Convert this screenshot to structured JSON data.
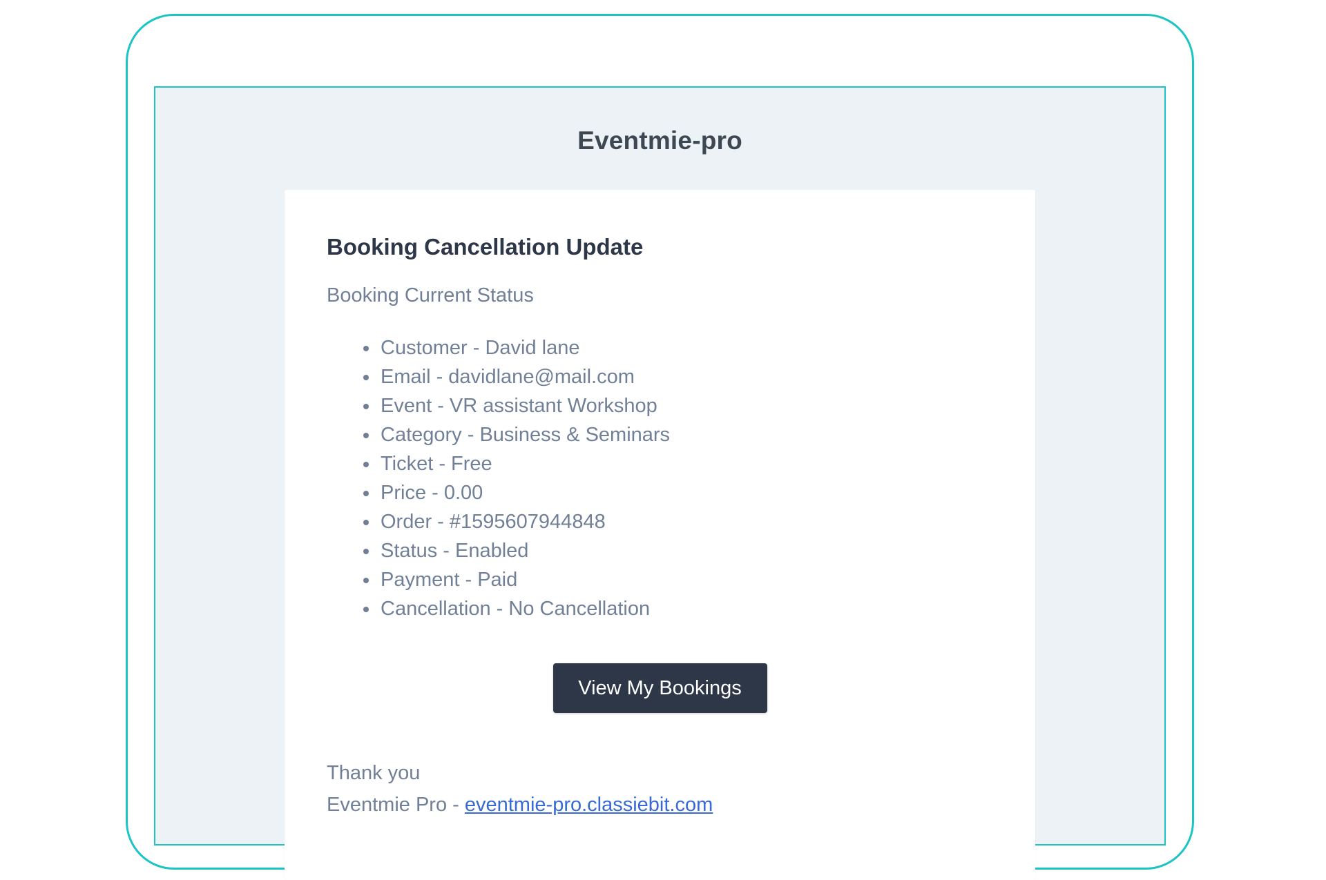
{
  "app": {
    "brand_name": "Eventmie-pro"
  },
  "email": {
    "heading": "Booking Cancellation Update",
    "subheading": "Booking Current Status",
    "details": [
      "Customer - David lane",
      "Email - davidlane@mail.com",
      "Event - VR assistant Workshop",
      "Category - Business & Seminars",
      "Ticket - Free",
      "Price - 0.00",
      "Order - #1595607944848",
      "Status - Enabled",
      "Payment - Paid",
      "Cancellation - No Cancellation"
    ],
    "button_label": "View My Bookings",
    "signoff_line": "Thank you",
    "signature_name": "Eventmie Pro -",
    "signature_link": "eventmie-pro.classiebit.com"
  },
  "colors": {
    "frame_accent": "#1cc4c6",
    "page_background": "#edf2f7",
    "button_background": "#2d3748",
    "link": "#3869d4",
    "body_text": "#718096",
    "heading_text": "#2d3748"
  }
}
